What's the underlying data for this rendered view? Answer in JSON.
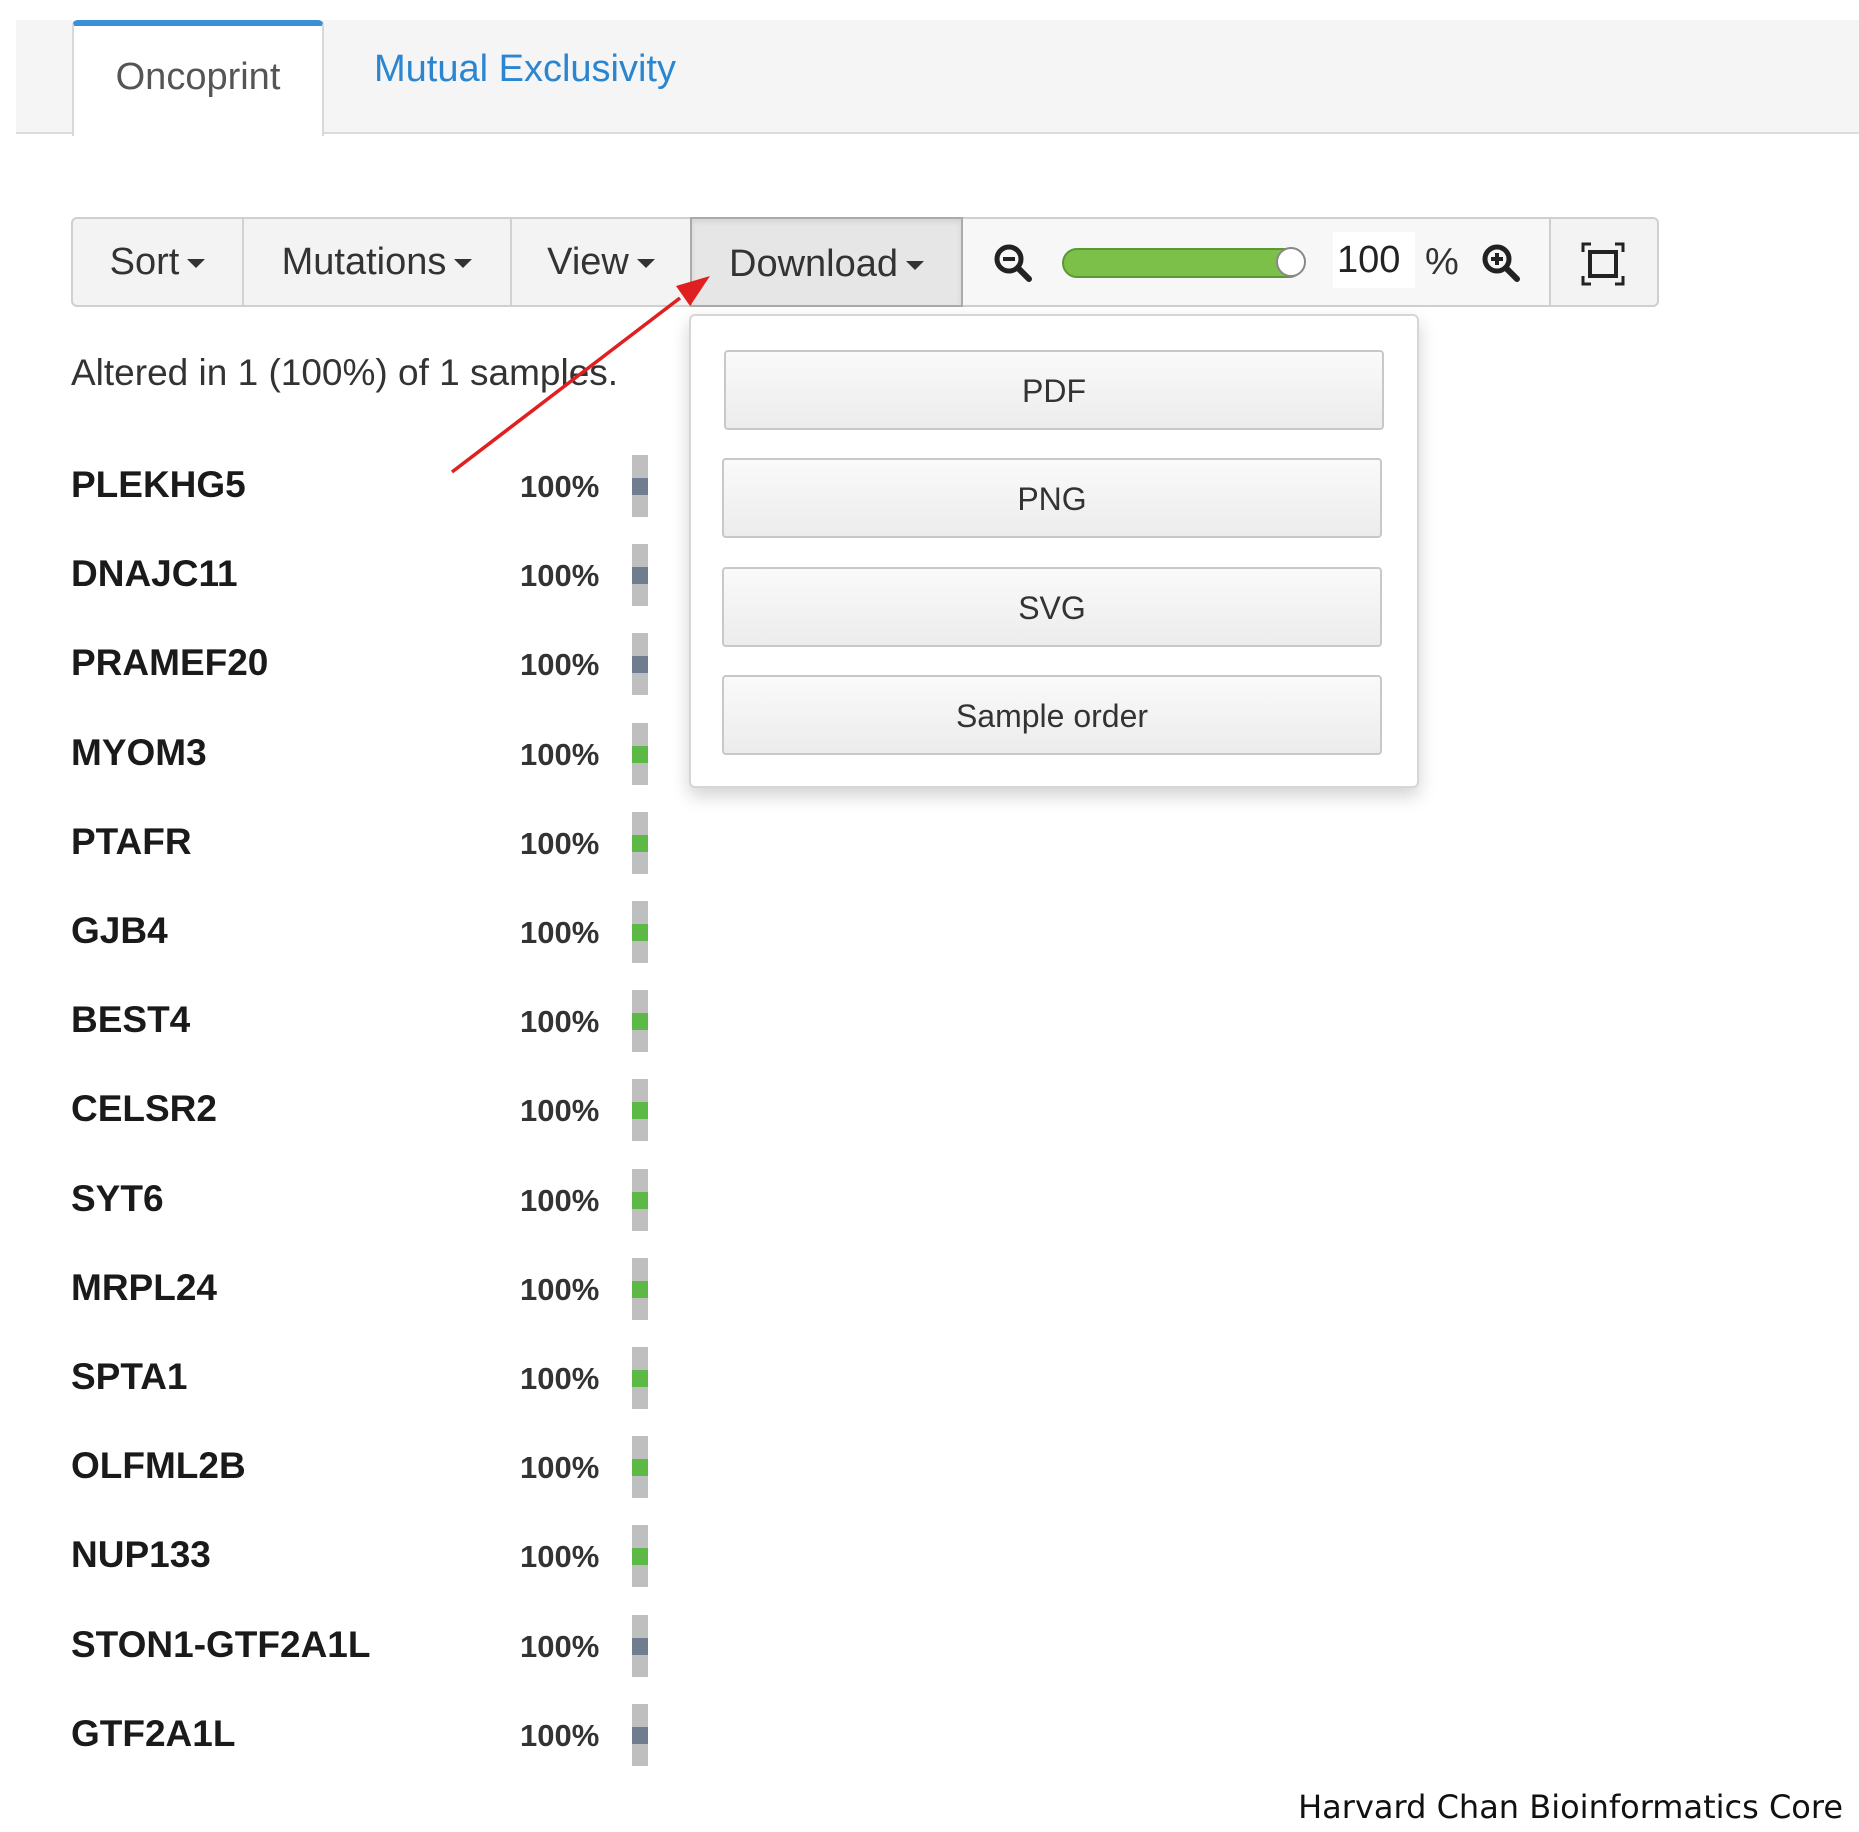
{
  "tabs": [
    {
      "label": "Oncoprint",
      "active": true
    },
    {
      "label": "Mutual Exclusivity",
      "active": false
    }
  ],
  "toolbar": {
    "sort_label": "Sort",
    "mutations_label": "Mutations",
    "view_label": "View",
    "download_label": "Download",
    "zoom_value": "100",
    "zoom_unit": "%",
    "zoom_level_fraction": 1.0
  },
  "download_menu": {
    "items": [
      "PDF",
      "PNG",
      "SVG",
      "Sample order"
    ]
  },
  "status_text": "Altered in 1 (100%) of 1 samples.",
  "genes": [
    {
      "name": "PLEKHG5",
      "pct": "100%",
      "mark": "gray"
    },
    {
      "name": "DNAJC11",
      "pct": "100%",
      "mark": "gray"
    },
    {
      "name": "PRAMEF20",
      "pct": "100%",
      "mark": "gray"
    },
    {
      "name": "MYOM3",
      "pct": "100%",
      "mark": "green"
    },
    {
      "name": "PTAFR",
      "pct": "100%",
      "mark": "green"
    },
    {
      "name": "GJB4",
      "pct": "100%",
      "mark": "green"
    },
    {
      "name": "BEST4",
      "pct": "100%",
      "mark": "green"
    },
    {
      "name": "CELSR2",
      "pct": "100%",
      "mark": "green"
    },
    {
      "name": "SYT6",
      "pct": "100%",
      "mark": "green"
    },
    {
      "name": "MRPL24",
      "pct": "100%",
      "mark": "green"
    },
    {
      "name": "SPTA1",
      "pct": "100%",
      "mark": "green"
    },
    {
      "name": "OLFML2B",
      "pct": "100%",
      "mark": "green"
    },
    {
      "name": "NUP133",
      "pct": "100%",
      "mark": "green"
    },
    {
      "name": "STON1-GTF2A1L",
      "pct": "100%",
      "mark": "gray"
    },
    {
      "name": "GTF2A1L",
      "pct": "100%",
      "mark": "gray"
    }
  ],
  "colors": {
    "accent": "#2a86d1",
    "mutation_green": "#5cb946",
    "mutation_gray": "#6f7d8f",
    "cell_bg": "#bfbfbf",
    "annotation_arrow": "#e02020"
  },
  "footer_credit": "Harvard Chan Bioinformatics Core"
}
